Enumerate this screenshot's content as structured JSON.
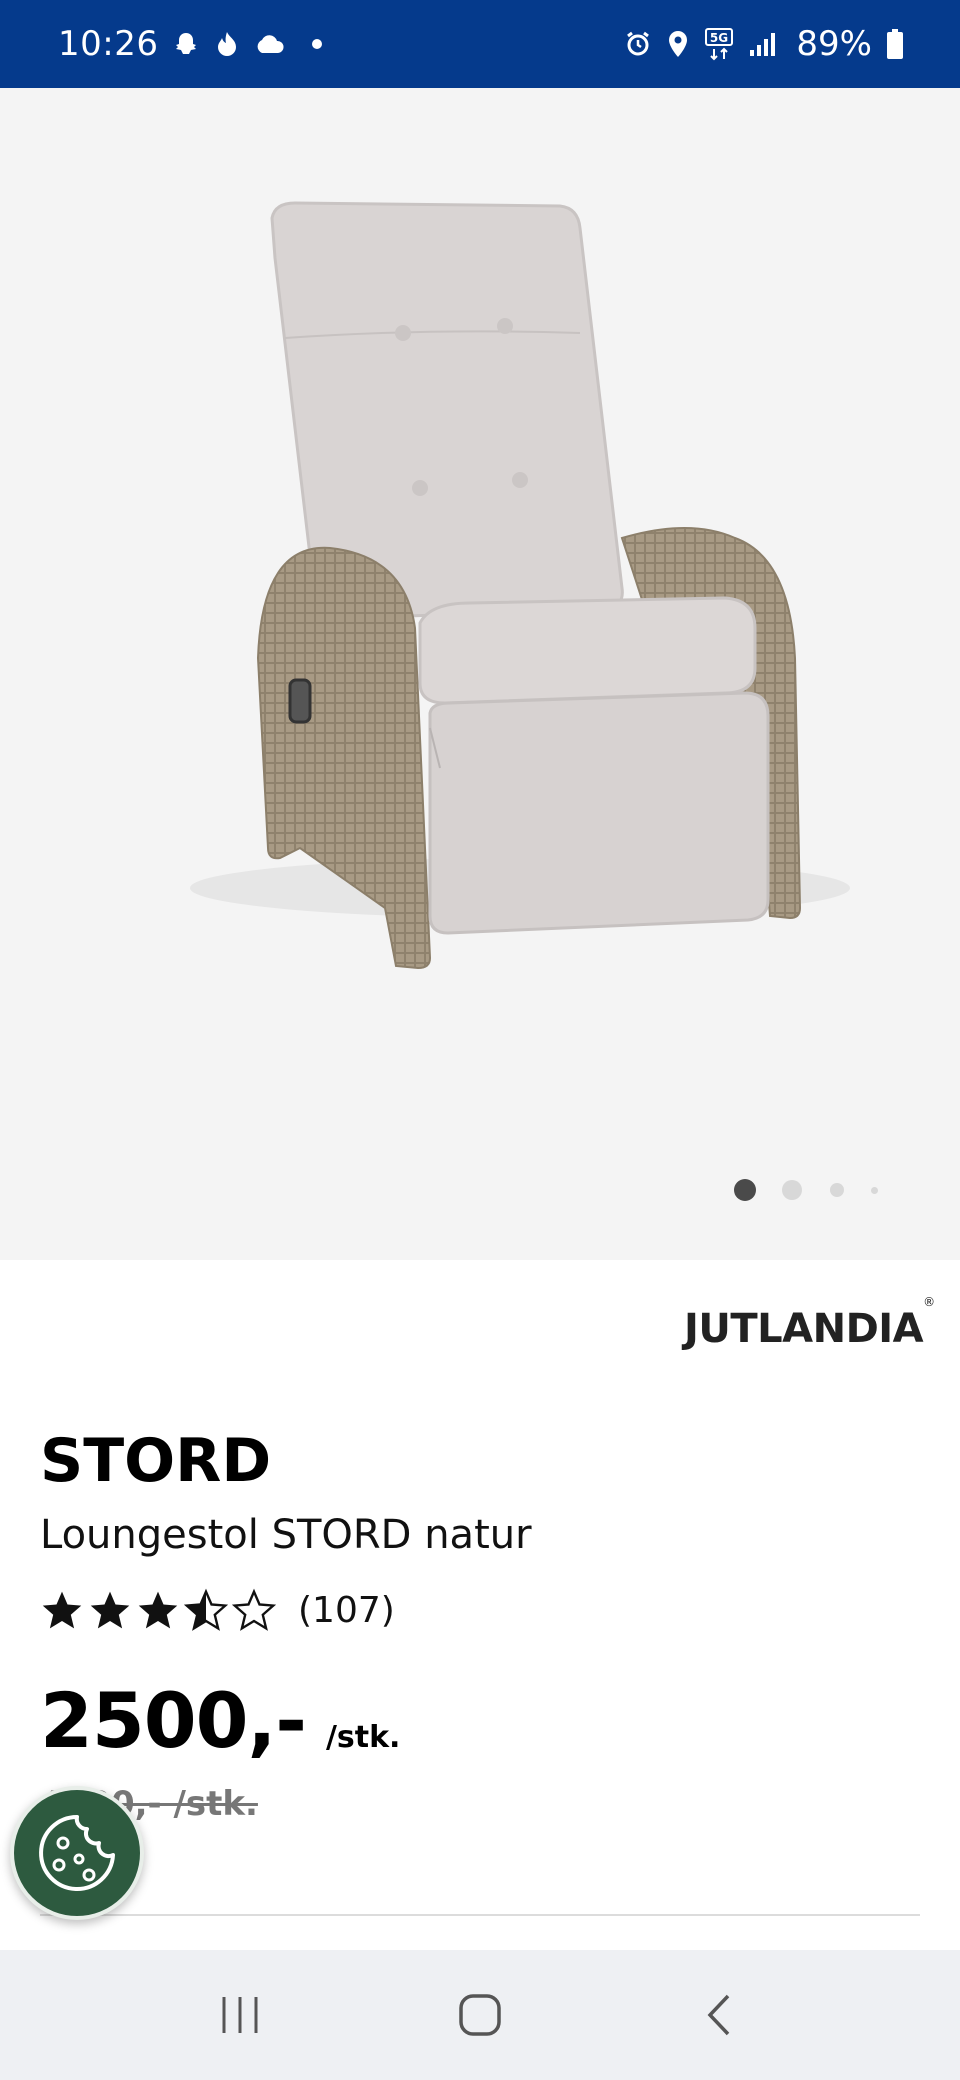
{
  "status_bar": {
    "time": "10:26",
    "battery": "89%",
    "left_icons": [
      "snapchat-icon",
      "fire-icon",
      "cloud-icon",
      "dot-icon"
    ],
    "right_icons": [
      "alarm-icon",
      "location-icon",
      "5g-icon",
      "signal-icon",
      "battery-icon"
    ]
  },
  "carousel": {
    "total": 4,
    "active": 1
  },
  "brand": {
    "name": "JUTLANDIA",
    "mark": "®"
  },
  "product": {
    "name": "STORD",
    "subtitle": "Loungestol STORD natur",
    "rating": 3.5,
    "rating_max": 5,
    "review_count": "(107)",
    "price": "2500,-",
    "unit": "/stk.",
    "old_price": "4000,- /stk."
  },
  "cookie_button": {
    "icon": "cookie-icon"
  },
  "nav": {
    "buttons": [
      "recent-apps",
      "home",
      "back"
    ]
  },
  "colors": {
    "status_bar": "#053a8c",
    "image_bg": "#f4f4f4",
    "cookie_bg": "#2d5a3f",
    "nav_bg": "#eef0f3"
  }
}
